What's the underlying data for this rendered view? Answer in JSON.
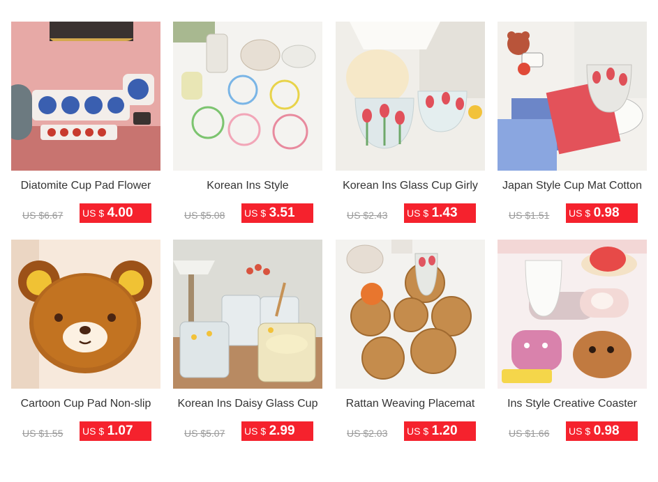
{
  "products": [
    {
      "title": "Diatomite Cup Pad Flower",
      "old_price": "US $6.67",
      "currency": "US $",
      "price": "4.00",
      "image": "diatomite-coaster-photo"
    },
    {
      "title": "Korean Ins Style",
      "old_price": "US $5.08",
      "currency": "US $",
      "price": "3.51",
      "image": "flower-coaster-photo"
    },
    {
      "title": "Korean Ins Glass Cup Girly",
      "old_price": "US $2.43",
      "currency": "US $",
      "price": "1.43",
      "image": "tulip-glass-photo"
    },
    {
      "title": "Japan Style Cup Mat Cotton",
      "old_price": "US $1.51",
      "currency": "US $",
      "price": "0.98",
      "image": "plaid-mat-photo"
    },
    {
      "title": "Cartoon Cup Pad Non-slip",
      "old_price": "US $1.55",
      "currency": "US $",
      "price": "1.07",
      "image": "bear-coaster-photo"
    },
    {
      "title": "Korean Ins Daisy Glass Cup",
      "old_price": "US $5.07",
      "currency": "US $",
      "price": "2.99",
      "image": "daisy-glass-photo"
    },
    {
      "title": "Rattan Weaving Placemat",
      "old_price": "US $2.03",
      "currency": "US $",
      "price": "1.20",
      "image": "rattan-placemat-photo"
    },
    {
      "title": "Ins Style Creative Coaster",
      "old_price": "US $1.66",
      "currency": "US $",
      "price": "0.98",
      "image": "creative-coaster-photo"
    }
  ],
  "colors": {
    "price_tag": "#f5222d",
    "old_price": "#999999",
    "title": "#333333"
  }
}
